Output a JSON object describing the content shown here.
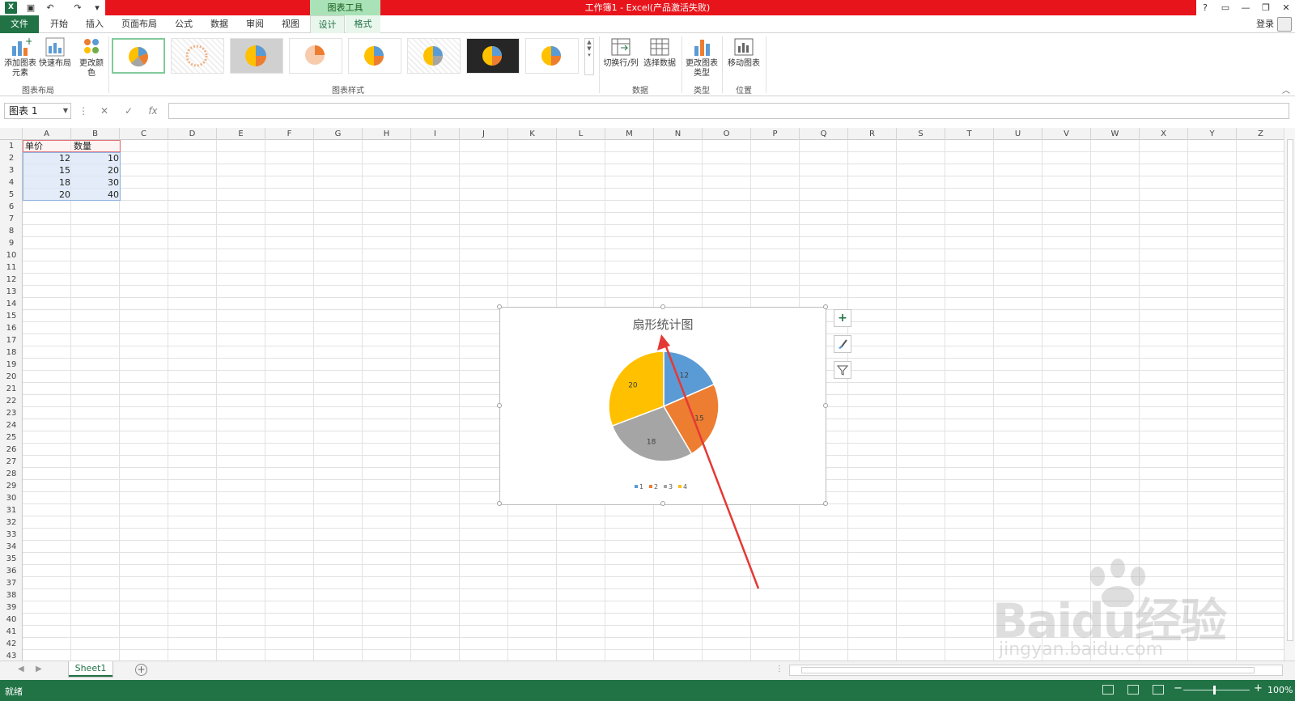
{
  "titlebar": {
    "title": "工作簿1 - Excel(产品激活失败)",
    "context_tab": "图表工具"
  },
  "tabs": [
    {
      "label": "文件"
    },
    {
      "label": "开始"
    },
    {
      "label": "插入"
    },
    {
      "label": "页面布局"
    },
    {
      "label": "公式"
    },
    {
      "label": "数据"
    },
    {
      "label": "审阅"
    },
    {
      "label": "视图"
    },
    {
      "label": "设计"
    },
    {
      "label": "格式"
    }
  ],
  "account": {
    "login_label": "登录"
  },
  "ribbon": {
    "add_element": "添加图表元素",
    "quick_layout": "快速布局",
    "change_colors": "更改颜色",
    "switch_row_col": "切换行/列",
    "select_data": "选择数据",
    "change_type": "更改图表类型",
    "move_chart": "移动图表",
    "groups": {
      "layout": "图表布局",
      "styles": "图表样式",
      "data": "数据",
      "type": "类型",
      "location": "位置"
    }
  },
  "formula_bar": {
    "name_box": "图表 1",
    "fx": "fx",
    "cancel": "✕",
    "enter": "✓",
    "formula": ""
  },
  "grid": {
    "columns": [
      "A",
      "B",
      "C",
      "D",
      "E",
      "F",
      "G",
      "H",
      "I",
      "J",
      "K",
      "L",
      "M",
      "N",
      "O",
      "P",
      "Q",
      "R",
      "S",
      "T",
      "U",
      "V",
      "W",
      "X",
      "Y",
      "Z"
    ],
    "rows": [
      "1",
      "2",
      "3",
      "4",
      "5",
      "6",
      "7",
      "8",
      "9",
      "10",
      "11",
      "12",
      "13",
      "14",
      "15",
      "16",
      "17",
      "18",
      "19",
      "20",
      "21",
      "22",
      "23",
      "24",
      "25",
      "26",
      "27",
      "28",
      "29",
      "30",
      "31",
      "32",
      "33",
      "34",
      "35",
      "36",
      "37",
      "38",
      "39",
      "40",
      "41",
      "42",
      "43"
    ],
    "headers": [
      "单价",
      "数量"
    ],
    "data": [
      [
        "12",
        "10"
      ],
      [
        "15",
        "20"
      ],
      [
        "18",
        "30"
      ],
      [
        "20",
        "40"
      ]
    ]
  },
  "chart_data": {
    "type": "pie",
    "title": "扇形统计图",
    "categories": [
      "1",
      "2",
      "3",
      "4"
    ],
    "values": [
      12,
      15,
      18,
      20
    ],
    "labels": [
      "12",
      "15",
      "18",
      "20"
    ],
    "colors": [
      "#5b9bd5",
      "#ed7d31",
      "#a5a5a5",
      "#ffc000"
    ],
    "legend": "bottom"
  },
  "sheets": {
    "active": "Sheet1"
  },
  "status": {
    "text": "就绪",
    "zoom": "100%"
  },
  "watermark": {
    "logo": "Baidu经验",
    "url": "jingyan.baidu.com"
  },
  "colors": {
    "excel_green": "#217346",
    "title_red": "#e8141b",
    "annotation_arrow": "#e53935"
  }
}
